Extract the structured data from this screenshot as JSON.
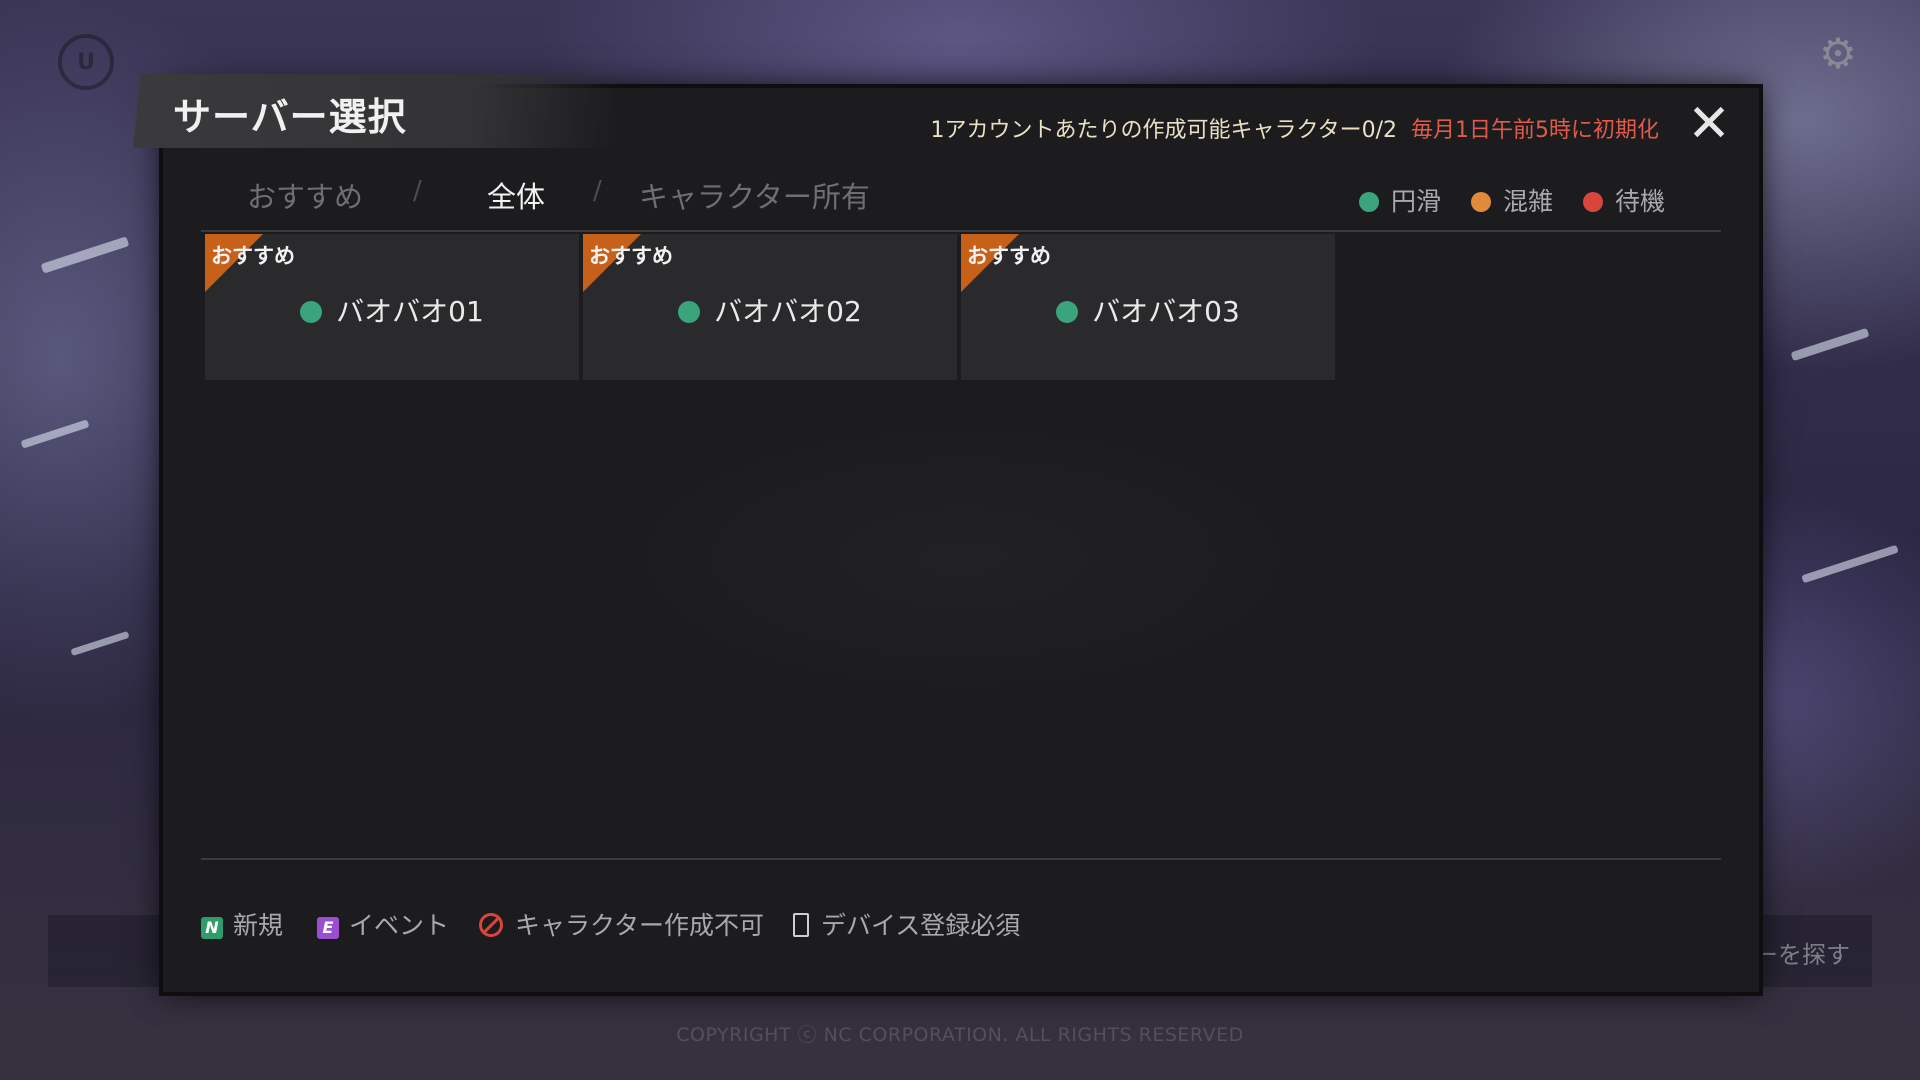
{
  "modal": {
    "title": "サーバー選択",
    "char_info": "1アカウントあたりの作成可能キャラクター0/2",
    "reset_info": "毎月1日午前5時に初期化",
    "close_icon": "close-icon"
  },
  "tabs": [
    {
      "label": "おすすめ",
      "active": false
    },
    {
      "label": "全体",
      "active": true
    },
    {
      "label": "キャラクター所有",
      "active": false
    }
  ],
  "tab_separator": "/",
  "status_legend": [
    {
      "label": "円滑",
      "color": "#3aa57c"
    },
    {
      "label": "混雑",
      "color": "#e08a3c"
    },
    {
      "label": "待機",
      "color": "#d8453c"
    }
  ],
  "servers": [
    {
      "name": "バオバオ01",
      "badge": "おすすめ",
      "status_color": "#3aa57c"
    },
    {
      "name": "バオバオ02",
      "badge": "おすすめ",
      "status_color": "#3aa57c"
    },
    {
      "name": "バオバオ03",
      "badge": "おすすめ",
      "status_color": "#3aa57c"
    }
  ],
  "footer_legend": {
    "new": {
      "icon_text": "N",
      "label": "新規"
    },
    "event": {
      "icon_text": "E",
      "label": "イベント"
    },
    "no_create": {
      "label": "キャラクター作成不可"
    },
    "device": {
      "label": "デバイス登録必須"
    }
  },
  "background": {
    "find_server": "ーを探す",
    "copyright": "COPYRIGHT ⓒ NC CORPORATION. ALL RIGHTS RESERVED"
  },
  "colors": {
    "accent_orange": "#c7611a",
    "status_green": "#3aa57c",
    "status_orange": "#e08a3c",
    "status_red": "#d8453c",
    "reset_text": "#e05b4a"
  }
}
